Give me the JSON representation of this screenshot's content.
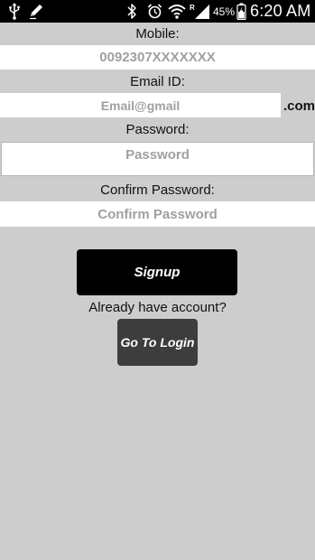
{
  "status_bar": {
    "battery_percent": "45%",
    "time": "6:20 AM",
    "icons": [
      "usb-icon",
      "pencil-icon",
      "bluetooth-icon",
      "alarm-icon",
      "wifi-icon",
      "signal-icon",
      "battery-icon"
    ]
  },
  "form": {
    "mobile": {
      "label": "Mobile:",
      "placeholder": "0092307XXXXXXX",
      "value": ""
    },
    "email": {
      "label": "Email ID:",
      "placeholder": "Email@gmail",
      "value": "",
      "suffix": ".com"
    },
    "password": {
      "label": "Password:",
      "placeholder": "Password",
      "value": ""
    },
    "confirm_password": {
      "label": "Confirm Password:",
      "placeholder": "Confirm Password",
      "value": ""
    }
  },
  "actions": {
    "signup_label": "Signup",
    "already_text": "Already have account?",
    "login_label": "Go To Login"
  },
  "colors": {
    "background": "#cdcdcd",
    "primary_button": "#000000",
    "secondary_button": "#3d3d3d",
    "placeholder": "#a0a0a0"
  }
}
